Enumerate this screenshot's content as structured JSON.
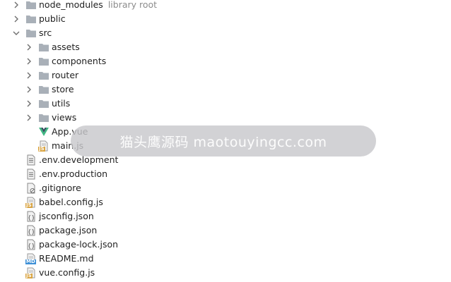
{
  "tree": {
    "node_modules": {
      "label": "node_modules",
      "hint": "library root"
    },
    "public": {
      "label": "public"
    },
    "src": {
      "label": "src",
      "children": {
        "assets": "assets",
        "components": "components",
        "router": "router",
        "store": "store",
        "utils": "utils",
        "views": "views",
        "app_vue": "App.vue",
        "main_js": "main.js"
      }
    },
    "files": {
      "env_development": ".env.development",
      "env_production": ".env.production",
      "gitignore": ".gitignore",
      "babel_config": "babel.config.js",
      "jsconfig": "jsconfig.json",
      "package_json": "package.json",
      "package_lock": "package-lock.json",
      "readme": "README.md",
      "vue_config": "vue.config.js"
    }
  },
  "badges": {
    "js": "JS",
    "md": "MD"
  },
  "watermark": {
    "text": "猫头鹰源码 maotouyingcc.com"
  },
  "colors": {
    "folder": "#a9b0b8",
    "vue_green": "#41b883",
    "vue_dark": "#35495e",
    "js_badge": "#d9a441",
    "md_badge": "#3d8fd6",
    "hint_text": "#8c8c8c"
  }
}
